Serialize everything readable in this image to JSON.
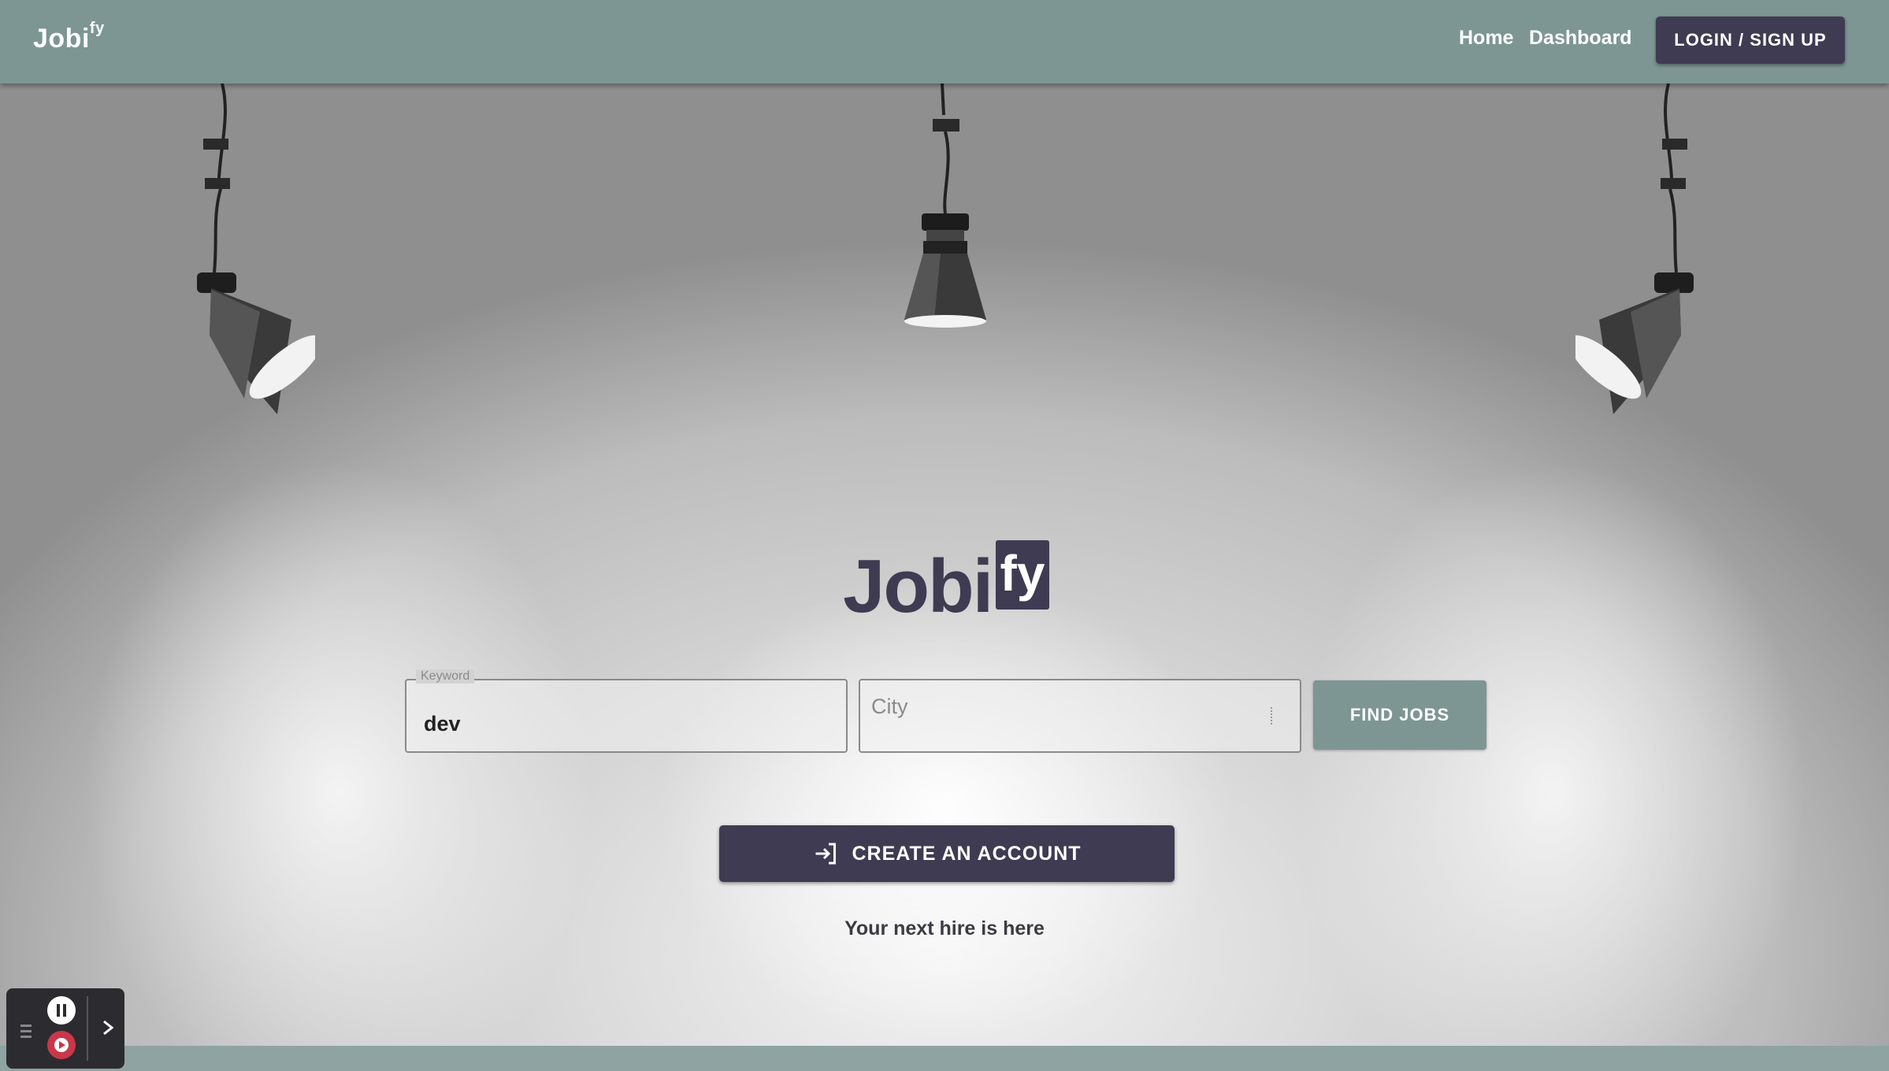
{
  "header": {
    "brand": "Jobi",
    "brand_sup": "fy",
    "nav": {
      "home": "Home",
      "dashboard": "Dashboard"
    },
    "login_label": "LOGIN / SIGN UP"
  },
  "hero": {
    "logo_main": "Jobi",
    "logo_badge": "fy",
    "search": {
      "keyword_legend": "Keyword",
      "keyword_value": "dev",
      "city_placeholder": "City",
      "find_label": "FIND JOBS"
    },
    "create_account_label": "CREATE AN ACCOUNT",
    "tagline": "Your next hire is here"
  },
  "colors": {
    "nav_bar": "#7d9694",
    "primary_dark": "#3f3b52",
    "find_button": "#7d9694",
    "record_red": "#c9384a"
  },
  "icons": {
    "create_account": "login-arrow-icon",
    "lamps": "spotlight-lamp-icon",
    "recorder": [
      "grip-icon",
      "pause-icon",
      "record-icon",
      "chevron-right-icon"
    ]
  }
}
